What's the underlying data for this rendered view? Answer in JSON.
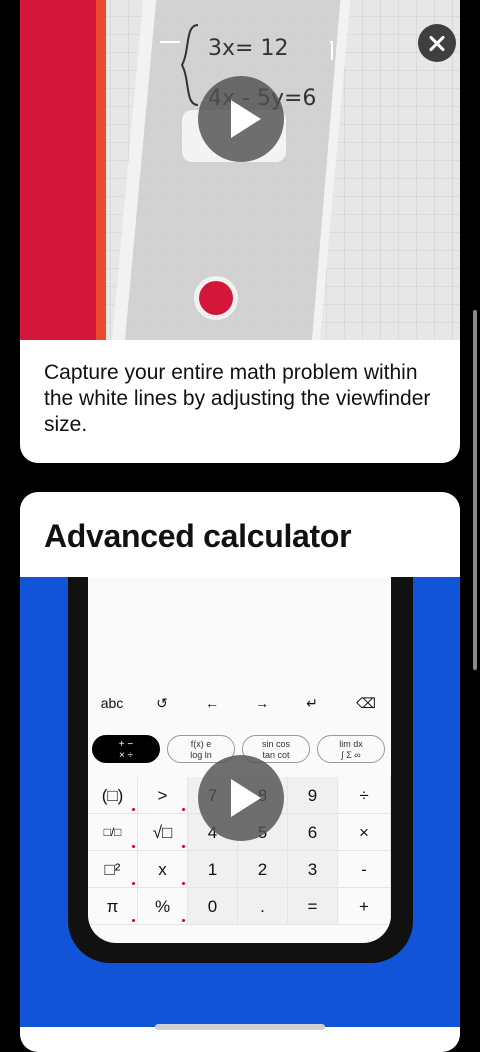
{
  "card1": {
    "equation_line1": "3x= 12",
    "equation_line2": "4x - 5y=6",
    "caption": "Capture your entire math problem within the white lines by adjusting the viewfinder size."
  },
  "card2": {
    "title": "Advanced calculator",
    "toolbar": [
      "abc",
      "↺",
      "←",
      "→",
      "↵",
      "⌫"
    ],
    "modes": [
      {
        "line1": "+ −",
        "line2": "× ÷"
      },
      {
        "line1": "f(x)  e",
        "line2": "log  ln"
      },
      {
        "line1": "sin cos",
        "line2": "tan cot"
      },
      {
        "line1": "lim  dx",
        "line2": "∫ Σ ∞"
      }
    ],
    "keys": [
      [
        "(□)",
        ">",
        "7",
        "8",
        "9",
        "÷"
      ],
      [
        "□/□",
        "√□",
        "4",
        "5",
        "6",
        "×"
      ],
      [
        "□²",
        "x",
        "1",
        "2",
        "3",
        "-"
      ],
      [
        "π",
        "%",
        "0",
        ".",
        "=",
        "+"
      ]
    ]
  },
  "colors": {
    "accent_red": "#d4163a",
    "accent_blue": "#1254d8"
  },
  "icons": {
    "close": "close-icon",
    "play": "play-icon",
    "history": "history-icon",
    "backspace": "backspace-icon"
  }
}
